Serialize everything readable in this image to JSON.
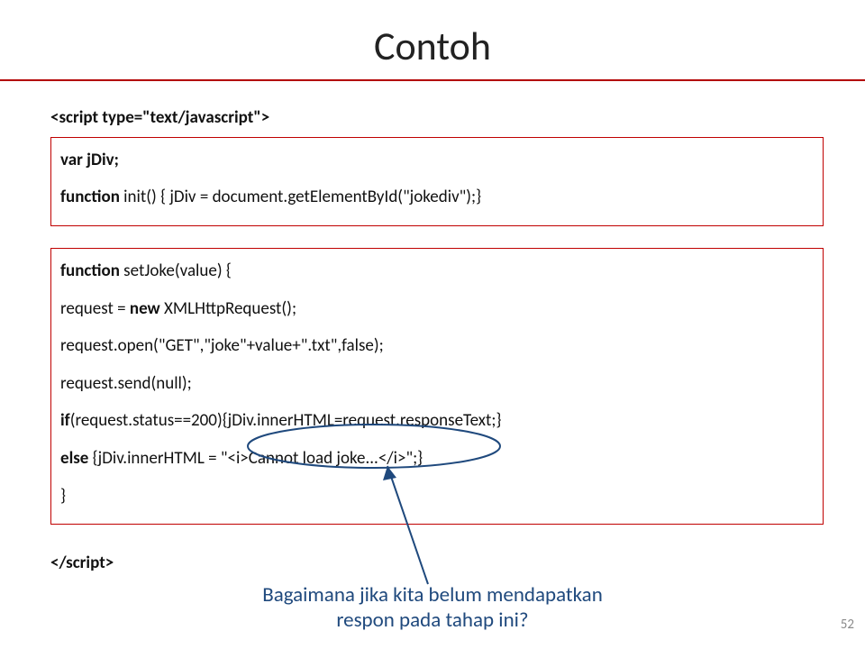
{
  "title": "Contoh",
  "code": {
    "open_tag": "<script type=\"text/javascript\">",
    "block1": {
      "l1": "var jDiv;",
      "l2_pre": "function",
      "l2_rest": " init() { jDiv = document.getElementById(\"jokediv\");}"
    },
    "block2": {
      "l1_pre": "function",
      "l1_rest": " setJoke(value) {",
      "l2_a": "  request = ",
      "l2_b": "new",
      "l2_c": " XMLHttpRequest();",
      "l3": "  request.open(\"GET\",\"joke\"+value+\".txt\",false);",
      "l4": "  request.send(null);",
      "l5_a": "  ",
      "l5_b": "if",
      "l5_c": "(request.status==200){jDiv.innerHTML=request.responseText;}",
      "l6_a": "  ",
      "l6_b": "else",
      "l6_c": " {jDiv.innerHTML = \"<i>Cannot load joke...</i>\";}",
      "l7": "}"
    },
    "close_tag": "</script>"
  },
  "callout": {
    "line1": "Bagaimana jika kita belum mendapatkan",
    "line2": "respon pada tahap ini?"
  },
  "page_number": "52"
}
